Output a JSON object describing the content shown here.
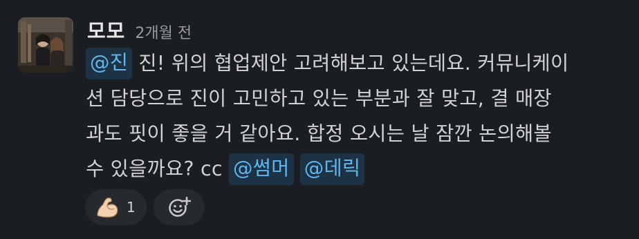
{
  "message": {
    "author": "모모",
    "timestamp": "2개월 전",
    "lines": [
      [
        {
          "type": "mention",
          "text": "@진"
        },
        {
          "type": "text",
          "text": " 진! 위의 협업제안 고려해보고 있는데요. 커뮤니케이"
        }
      ],
      [
        {
          "type": "text",
          "text": "션 담당으로 진이 고민하고 있는 부분과 잘 맞고, 결 매장"
        }
      ],
      [
        {
          "type": "text",
          "text": "과도 핏이 좋을 거 같아요. 합정 오시는 날 잠깐 논의해볼"
        }
      ],
      [
        {
          "type": "text",
          "text": "수 있을까요? cc "
        },
        {
          "type": "mention",
          "text": "@썸머"
        },
        {
          "type": "text",
          "text": " "
        },
        {
          "type": "mention",
          "text": "@데릭"
        }
      ]
    ]
  },
  "reactions": [
    {
      "emoji": "flexed-biceps-icon",
      "count": "1"
    }
  ],
  "add_reaction": {
    "icon": "add-reaction-icon"
  },
  "colors": {
    "background": "#1a1d21",
    "mention_bg": "#1d3345",
    "mention_text": "#5fb6ee",
    "pill_bg": "#26292d"
  }
}
